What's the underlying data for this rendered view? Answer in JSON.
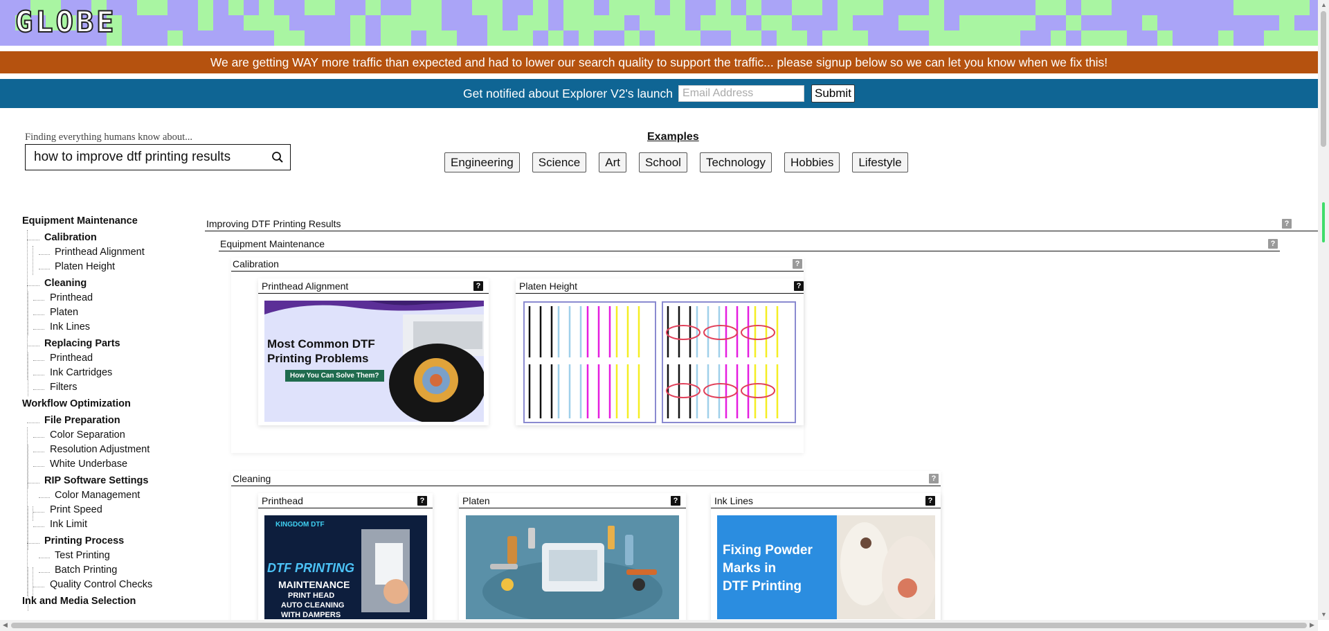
{
  "header": {
    "logo": "GLOBE"
  },
  "banner": {
    "notice": "We are getting WAY more traffic than expected and had to lower our search quality to support the traffic... please signup below so we can let you know when we fix this!",
    "notify_label": "Get notified about Explorer V2's launch",
    "email_placeholder": "Email Address",
    "submit_label": "Submit"
  },
  "search": {
    "caption": "Finding everything humans know about...",
    "value": "how to improve dtf printing results",
    "icon": "search-icon"
  },
  "examples": {
    "title": "Examples",
    "chips": [
      "Engineering",
      "Science",
      "Art",
      "School",
      "Technology",
      "Hobbies",
      "Lifestyle"
    ]
  },
  "sidebar": {
    "categories": [
      {
        "label": "Equipment Maintenance",
        "groups": [
          {
            "label": "Calibration",
            "items": [
              "Printhead Alignment",
              "Platen Height"
            ]
          },
          {
            "label": "Cleaning",
            "items": [
              "Printhead",
              "Platen",
              "Ink Lines"
            ]
          },
          {
            "label": "Replacing Parts",
            "items": [
              "Printhead",
              "Ink Cartridges",
              "Filters"
            ]
          }
        ]
      },
      {
        "label": "Workflow Optimization",
        "groups": [
          {
            "label": "File Preparation",
            "items": [
              "Color Separation",
              "Resolution Adjustment",
              "White Underbase"
            ]
          },
          {
            "label": "RIP Software Settings",
            "items": [
              "Color Management",
              "Print Speed",
              "Ink Limit"
            ]
          },
          {
            "label": "Printing Process",
            "items": [
              "Test Printing",
              "Batch Printing",
              "Quality Control Checks"
            ]
          }
        ]
      },
      {
        "label": "Ink and Media Selection",
        "groups": []
      }
    ]
  },
  "main": {
    "root_title": "Improving DTF Printing Results",
    "section_title": "Equipment Maintenance",
    "calibration": {
      "title": "Calibration",
      "cards": [
        {
          "title": "Printhead Alignment",
          "img_heading": "Most Common DTF Printing Problems",
          "img_line1": "Most Common DTF",
          "img_line2": "Printing Problems",
          "img_sub": "How You Can Solve Them?"
        },
        {
          "title": "Platen Height"
        }
      ]
    },
    "cleaning": {
      "title": "Cleaning",
      "cards": [
        {
          "title": "Printhead",
          "img_brand": "KINGDOM DTF",
          "img_title": "DTF PRINTING",
          "img_l1": "MAINTENANCE",
          "img_l2": "PRINT HEAD",
          "img_l3": "AUTO CLEANING",
          "img_l4": "WITH DAMPERS"
        },
        {
          "title": "Platen"
        },
        {
          "title": "Ink Lines",
          "img_l1": "Fixing Powder",
          "img_l2": "Marks in",
          "img_l3": "DTF Printing"
        }
      ]
    },
    "help_glyph": "?"
  },
  "colors": {
    "orange_banner": "#b5520f",
    "blue_banner": "#0f6594",
    "mosaic_purple": "#aaa4f7",
    "mosaic_green": "#a9f5a2"
  }
}
